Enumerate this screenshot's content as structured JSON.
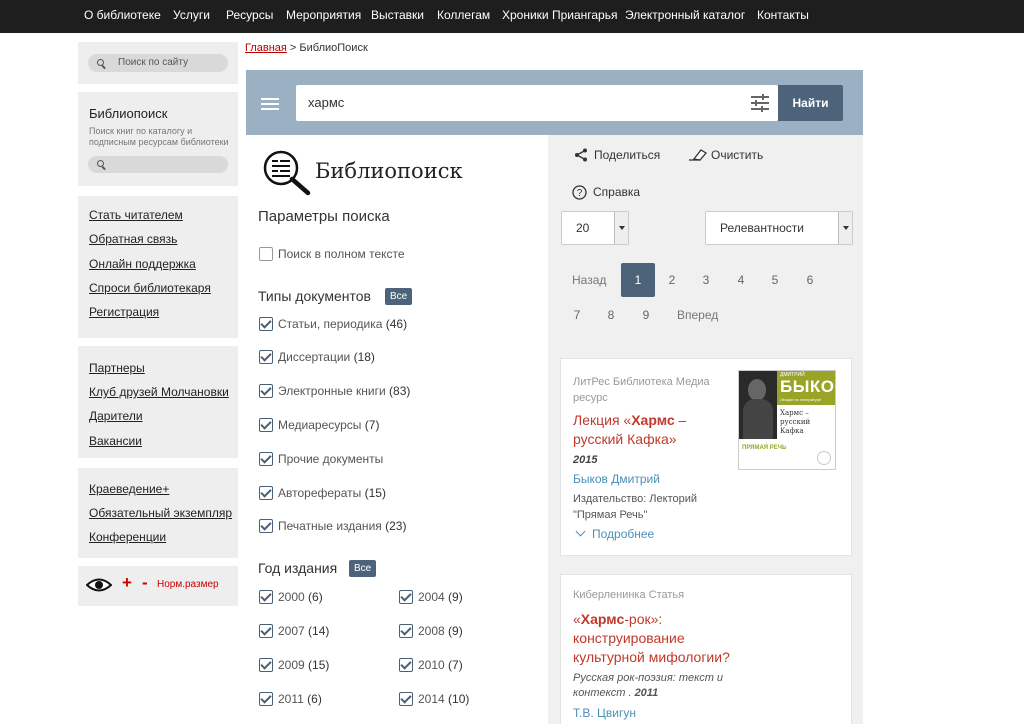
{
  "topnav": {
    "items": [
      "О библиотеке",
      "Услуги",
      "Ресурсы",
      "Мероприятия",
      "Выставки",
      "Коллегам",
      "Хроники Приангарья",
      "Электронный каталог",
      "Контакты"
    ]
  },
  "sidebar": {
    "site_search_placeholder": "Поиск по сайту",
    "biblio_title": "Библиопоиск",
    "biblio_desc": "Поиск книг по каталогу и подписным ресурсам библиотеки",
    "group1": [
      "Стать читателем",
      "Обратная связь",
      "Онлайн поддержка",
      "Спроси библиотекаря",
      "Регистрация"
    ],
    "group2": [
      "Партнеры",
      "Клуб друзей Молчановки",
      "Дарители",
      "Вакансии"
    ],
    "group3": [
      "Краеведение+",
      "Обязательный экземпляр",
      "Конференции"
    ],
    "accessibility": {
      "plus": "+",
      "minus": "-",
      "normal": "Норм.размер"
    }
  },
  "breadcrumb": {
    "home": "Главная",
    "sep": " > ",
    "current": "БиблиоПоиск"
  },
  "search": {
    "query": "хармс",
    "button": "Найти"
  },
  "filters": {
    "logo_text": "Библиопоиск",
    "heading": "Параметры поиска",
    "fulltext_label": "Поиск в полном тексте",
    "doc_types_heading": "Типы документов",
    "all_badge": "Все",
    "doc_types": [
      {
        "label": "Статьи, периодика",
        "count": "(46)"
      },
      {
        "label": "Диссертации",
        "count": "(18)"
      },
      {
        "label": "Электронные книги",
        "count": "(83)"
      },
      {
        "label": "Медиаресурсы",
        "count": "(7)"
      },
      {
        "label": "Прочие документы",
        "count": ""
      },
      {
        "label": "Авторефераты",
        "count": "(15)"
      },
      {
        "label": "Печатные издания",
        "count": "(23)"
      }
    ],
    "year_heading": "Год издания",
    "years": [
      {
        "label": "2000",
        "count": "(6)"
      },
      {
        "label": "2004",
        "count": "(9)"
      },
      {
        "label": "2007",
        "count": "(14)"
      },
      {
        "label": "2008",
        "count": "(9)"
      },
      {
        "label": "2009",
        "count": "(15)"
      },
      {
        "label": "2010",
        "count": "(7)"
      },
      {
        "label": "2011",
        "count": "(6)"
      },
      {
        "label": "2014",
        "count": "(10)"
      }
    ]
  },
  "results": {
    "share": "Поделиться",
    "clear": "Очистить",
    "help": "Справка",
    "per_page": "20",
    "sort": "Релевантности",
    "pagination": {
      "prev": "Назад",
      "pages": [
        "1",
        "2",
        "3",
        "4",
        "5",
        "6",
        "7",
        "8",
        "9"
      ],
      "next": "Вперед",
      "current": "1"
    },
    "cards": [
      {
        "source": "ЛитРес Библиотека Медиа ресурс",
        "title_pre": "Лекция «",
        "title_hl": "Хармс",
        "title_post": " – русский Кафка»",
        "year": "2015",
        "author": "Быков Дмитрий",
        "publisher": "Издательство: Лекторий \"Прямая Речь\"",
        "more": "Подробнее",
        "cover": {
          "author_small": "ДМИТРИЙ",
          "author_big": "БЫКОВ",
          "subtitle": "Лекции по литературе",
          "title": "Хармс – русский Кафка",
          "brand": "ПРЯМАЯ РЕЧЬ"
        }
      },
      {
        "source": "Киберленинка Статья",
        "title_pre": "«",
        "title_hl": "Хармс",
        "title_post": "-рок»: конструирование культурной мифологии?",
        "italic": "Русская рок-поэзия: текст и контекст",
        "year": "2011",
        "author": "Т.В. Цвигун"
      }
    ]
  }
}
